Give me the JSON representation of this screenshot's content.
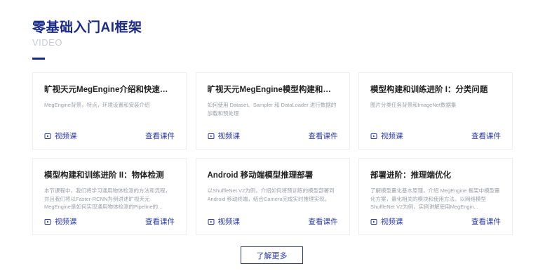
{
  "section": {
    "title": "零基础入门AI框架",
    "subtitle": "VIDEO"
  },
  "cards": [
    {
      "title": "旷视天元MegEngine介绍和快速上手",
      "desc": "MegEngine背景，特点，环境设置和安装介绍",
      "tag": "视频课",
      "link": "查看课件"
    },
    {
      "title": "旷视天元MegEngine模型构建和训练...",
      "desc": "如何使用 Dataset、Sampler 和 DataLoader 进行数据的加载和预处理",
      "tag": "视频课",
      "link": "查看课件"
    },
    {
      "title": "模型构建和训练进阶 I：分类问题",
      "desc": "图片分类任务背景和ImageNet数据集",
      "tag": "视频课",
      "link": "查看课件"
    },
    {
      "title": "模型构建和训练进阶 II：物体检测",
      "desc": "本节课程中，我们将学习通用物体检测的方法和流程，并且我们将以Faster-RCNN为例讲述旷视天元MegEngine是如何实现通用物体检测的Pipeline的...",
      "tag": "视频课",
      "link": "查看课件"
    },
    {
      "title": "Android 移动端模型推理部署",
      "desc": "以ShuffleNet V2为例，介绍如何将预训练的模型部署到Android 移动终端，结合Camera完成实时推理实现。",
      "tag": "视频课",
      "link": "查看课件"
    },
    {
      "title": "部署进阶：推理端优化",
      "desc": "了解模型量化基本原理，介绍 MegEngine 框架中模型量化方案，量化相关的模块和使用方法。以网络模型ShuffleNet V2为例，实例讲解使用MegEngin...",
      "tag": "视频课",
      "link": "查看课件"
    }
  ],
  "more_button": "了解更多",
  "colors": {
    "brand": "#1a2a8a",
    "accent": "#2b3aa8",
    "muted": "#9a9ea8"
  },
  "icons": {
    "tag_icon": "video-play-icon"
  }
}
